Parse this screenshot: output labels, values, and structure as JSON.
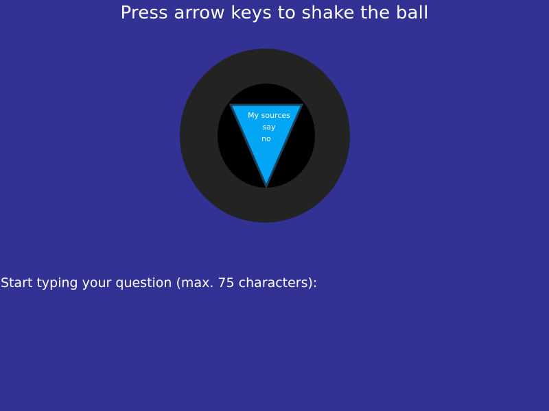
{
  "instruction": "Press arrow keys to shake the ball",
  "ball": {
    "answer_lines": [
      "My sources",
      "say",
      "no"
    ]
  },
  "question": {
    "prompt": "Start typing your question (max. 75 characters):",
    "value": ""
  },
  "colors": {
    "background": "#313294",
    "ball_outer": "#232323",
    "ball_window": "#000000",
    "triangle": "#03a6f5",
    "triangle_border": "#1c3f5a",
    "text": "#ffffff"
  }
}
